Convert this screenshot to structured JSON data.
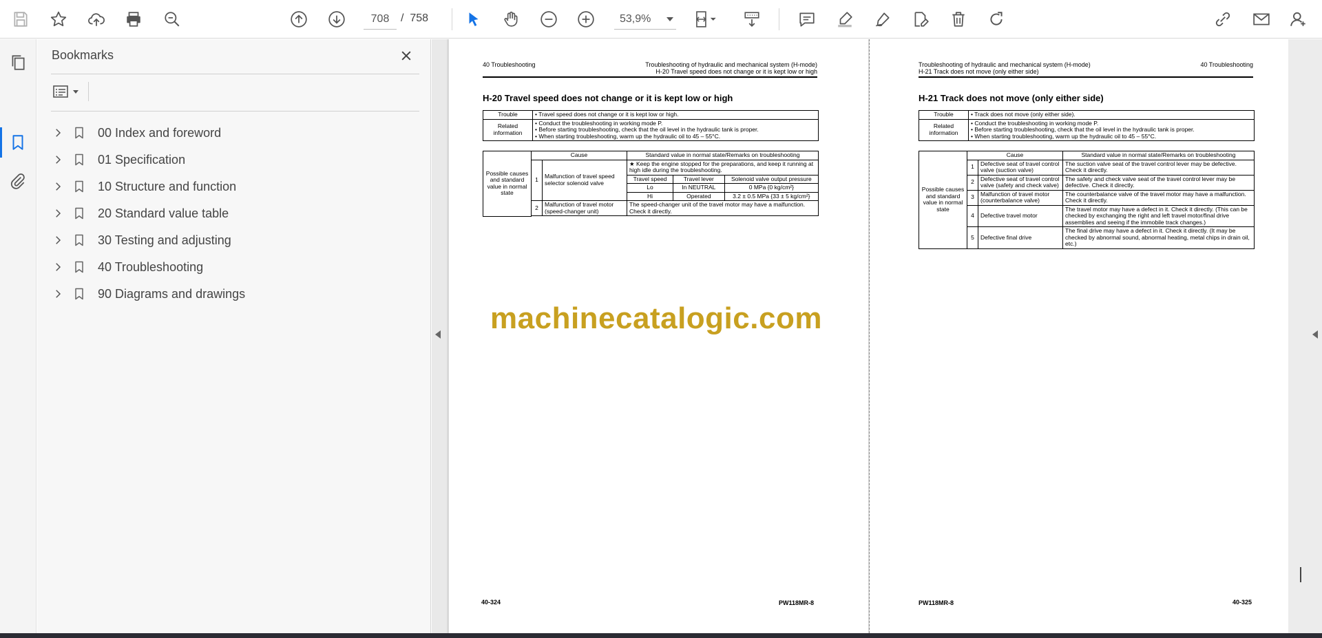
{
  "toolbar": {
    "page_current": "708",
    "page_separator": "/",
    "page_total": "758",
    "zoom_value": "53,9%"
  },
  "bookmarks": {
    "title": "Bookmarks",
    "items": [
      {
        "label": "00 Index and foreword"
      },
      {
        "label": "01 Specification"
      },
      {
        "label": "10 Structure and function"
      },
      {
        "label": "20 Standard value table"
      },
      {
        "label": "30 Testing and adjusting"
      },
      {
        "label": "40 Troubleshooting"
      },
      {
        "label": "90 Diagrams and drawings"
      }
    ]
  },
  "left_page": {
    "header_left": "40 Troubleshooting",
    "header_right_1": "Troubleshooting of hydraulic and mechanical system (H-mode)",
    "header_right_2": "H-20 Travel speed does not change or it is kept low or high",
    "title": "H-20 Travel speed does not change or it is kept low or high",
    "trouble_label": "Trouble",
    "trouble_text": "•  Travel speed does not change or it is kept low or high.",
    "related_label": "Related information",
    "related_1": "•  Conduct the troubleshooting in working mode P.",
    "related_2": "•  Before starting troubleshooting, check that the oil level in the hydraulic tank is proper.",
    "related_3": "•  When starting troubleshooting, warm up the hydraulic oil to 45 – 55°C.",
    "possible_label": "Possible causes and standard value in normal state",
    "cause_header": "Cause",
    "std_header": "Standard value in normal state/Remarks on troubleshooting",
    "row1_no": "1",
    "row1_cause": "Malfunction of travel speed selector solenoid valve",
    "row1_note": "★   Keep the engine stopped for the preparations, and keep it running at high idle during the troubleshooting.",
    "sub_h1": "Travel speed",
    "sub_h2": "Travel lever",
    "sub_h3": "Solenoid valve output pressure",
    "sub_r1_a": "Lo",
    "sub_r1_b": "In NEUTRAL",
    "sub_r1_c": "0 MPa {0 kg/cm²}",
    "sub_r2_a": "Hi",
    "sub_r2_b": "Operated",
    "sub_r2_c": "3.2 ± 0.5 MPa {33 ± 5 kg/cm²}",
    "row2_no": "2",
    "row2_cause": "Malfunction of travel motor (speed-changer unit)",
    "row2_std": "The speed-changer unit of the travel motor may have a malfunction.  Check it directly.",
    "footer_left": "40-324",
    "footer_right": "PW118MR-8"
  },
  "right_page": {
    "header_left_1": "Troubleshooting of hydraulic and mechanical system (H-mode)",
    "header_left_2": "H-21 Track does not move (only either side)",
    "header_right": "40 Troubleshooting",
    "title": "H-21 Track does not move (only either side)",
    "trouble_label": "Trouble",
    "trouble_text": "•  Track does not move (only either side).",
    "related_label": "Related information",
    "related_1": "•  Conduct the troubleshooting in working mode P.",
    "related_2": "•  Before starting troubleshooting, check that the oil level in the hydraulic tank is proper.",
    "related_3": "•  When starting troubleshooting, warm up the hydraulic oil to 45 – 55°C.",
    "possible_label": "Possible causes and standard value in normal state",
    "cause_header": "Cause",
    "std_header": "Standard value in normal state/Remarks on troubleshooting",
    "rows": [
      {
        "no": "1",
        "cause": "Defective seat of travel control valve (suction valve)",
        "std": "The suction valve seat of the travel control lever may be defective.  Check it directly."
      },
      {
        "no": "2",
        "cause": "Defective seat of travel control valve (safety and check valve)",
        "std": "The safety and check valve seat of the travel control lever may be defective.  Check it directly."
      },
      {
        "no": "3",
        "cause": "Malfunction of travel motor (counterbalance valve)",
        "std": "The counterbalance valve of the travel motor may have a malfunction.  Check it directly."
      },
      {
        "no": "4",
        "cause": "Defective travel motor",
        "std": "The travel motor may have a defect in it.  Check it directly. (This can be checked by exchanging the right and left travel motor/final drive assemblies and seeing if the immobile track changes.)"
      },
      {
        "no": "5",
        "cause": "Defective final drive",
        "std": "The final drive may have a defect in it.  Check it directly.  (It may be checked by abnormal sound, abnormal heating, metal chips in drain oil, etc.)"
      }
    ],
    "footer_left": "PW118MR-8",
    "footer_right": "40-325"
  },
  "watermark": "machinecatalogic.com",
  "colors": {
    "accent_blue": "#1473e6",
    "watermark_gold": "#c8a020"
  }
}
